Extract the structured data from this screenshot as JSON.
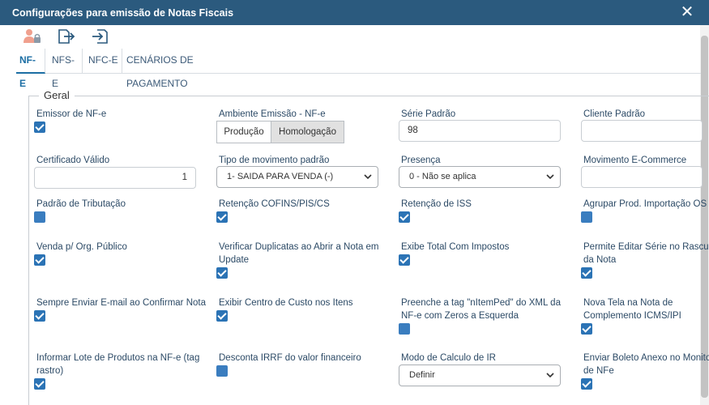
{
  "window": {
    "title": "Configurações para emissão de Notas Fiscais",
    "close_glyph": "✕"
  },
  "toolbar": {
    "icons": [
      "user-lock-icon",
      "export-icon",
      "import-icon"
    ]
  },
  "tabs": [
    "NF-E",
    "NFS-E",
    "NFC-E",
    "CENÁRIOS DE PAGAMENTO"
  ],
  "section": {
    "legend": "Geral"
  },
  "fields": {
    "emissor_nfe": {
      "label": "Emissor de NF-e",
      "checked": true
    },
    "ambiente": {
      "label": "Ambiente Emissão - NF-e",
      "options": [
        "Produção",
        "Homologação"
      ],
      "selected": "Homologação"
    },
    "serie_padrao": {
      "label": "Série Padrão",
      "value": "98"
    },
    "cliente_padrao": {
      "label": "Cliente Padrão",
      "value": ""
    },
    "certificado_valido": {
      "label": "Certificado Válido",
      "value": "1"
    },
    "tipo_movimento": {
      "label": "Tipo de movimento padrão",
      "value": "1- SAIDA PARA VENDA (-)"
    },
    "presenca": {
      "label": "Presença",
      "value": "0 - Não se aplica"
    },
    "movimento_ecommerce": {
      "label": "Movimento E-Commerce",
      "value": ""
    },
    "padrao_tributacao": {
      "label": "Padrão de Tributação",
      "checked": false
    },
    "retencao_cofins": {
      "label": "Retenção COFINS/PIS/CS",
      "checked": true
    },
    "retencao_iss": {
      "label": "Retenção de ISS",
      "checked": true
    },
    "agrupar_prod": {
      "label": "Agrupar Prod. Importação OS",
      "checked": false
    },
    "venda_org_publico": {
      "label": "Venda p/ Org. Público",
      "checked": true
    },
    "verificar_duplicatas": {
      "label": "Verificar Duplicatas ao Abrir a Nota em Update",
      "checked": true
    },
    "exibe_total_impostos": {
      "label": "Exibe Total Com Impostos",
      "checked": true
    },
    "permite_editar_serie": {
      "label": "Permite Editar Série no Rascunho da Nota",
      "checked": true
    },
    "sempre_enviar_email": {
      "label": "Sempre Enviar E-mail ao Confirmar Nota",
      "checked": true
    },
    "exibir_centro_custo": {
      "label": "Exibir Centro de Custo nos Itens",
      "checked": true
    },
    "preenche_tag": {
      "label": "Preenche a tag \"nItemPed\" do XML da NF-e com Zeros a Esquerda",
      "checked": false
    },
    "nova_tela": {
      "label": "Nova Tela na Nota de Complemento ICMS/IPI",
      "checked": true
    },
    "informar_lote": {
      "label": "Informar Lote de Produtos na NF-e (tag rastro)",
      "checked": true
    },
    "desconta_irrf": {
      "label": "Desconta IRRF do valor financeiro",
      "checked": false
    },
    "modo_calculo_ir": {
      "label": "Modo de Calculo de IR",
      "value": "Definir"
    },
    "enviar_boleto": {
      "label": "Enviar Boleto Anexo no Monitor de NFe",
      "checked": true
    }
  },
  "colors": {
    "titlebar": "#2b5a7e",
    "accent": "#2b73b5",
    "tab_active": "#1c6ea4"
  }
}
